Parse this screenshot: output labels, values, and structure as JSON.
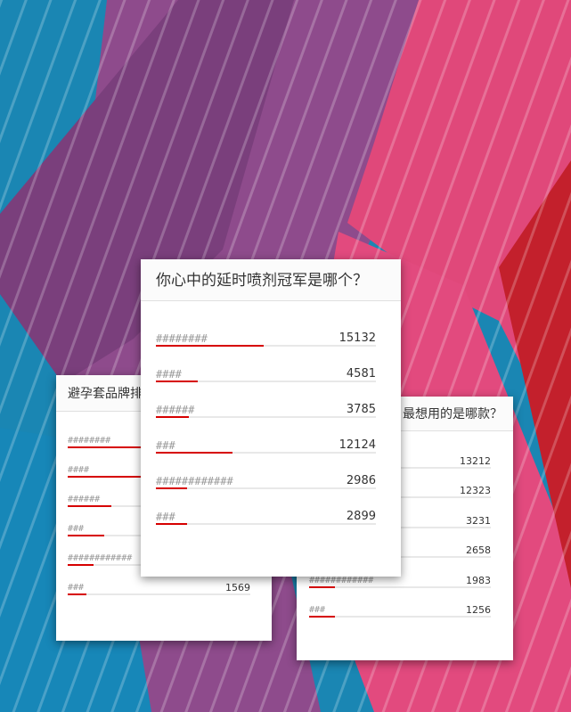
{
  "background": {
    "colors": [
      "#1a86b3",
      "#8e4b8c",
      "#e0487a",
      "#c3202c"
    ]
  },
  "polls": [
    {
      "title": "避孕套品牌排",
      "accent_color": "#d60000",
      "items": [
        {
          "name": "########",
          "votes": "",
          "fill": 0.58
        },
        {
          "name": "####",
          "votes": "",
          "fill": 0.56
        },
        {
          "name": "######",
          "votes": "",
          "fill": 0.24
        },
        {
          "name": "###",
          "votes": "",
          "fill": 0.2
        },
        {
          "name": "############",
          "votes": "",
          "fill": 0.14
        },
        {
          "name": "###",
          "votes": "1569",
          "fill": 0.1
        }
      ]
    },
    {
      "title": "最想用的是哪款？",
      "accent_color": "#d60000",
      "items": [
        {
          "name": "",
          "votes": "13212",
          "fill": 0
        },
        {
          "name": "",
          "votes": "12323",
          "fill": 0
        },
        {
          "name": "",
          "votes": "3231",
          "fill": 0
        },
        {
          "name": "",
          "votes": "2658",
          "fill": 0
        },
        {
          "name": "############",
          "votes": "1983",
          "fill": 0.14
        },
        {
          "name": "###",
          "votes": "1256",
          "fill": 0.14
        }
      ]
    },
    {
      "title": "你心中的延时喷剂冠军是哪个？",
      "accent_color": "#d60000",
      "items": [
        {
          "name": "########",
          "votes": "15132",
          "fill": 0.49
        },
        {
          "name": "####",
          "votes": "4581",
          "fill": 0.19
        },
        {
          "name": "######",
          "votes": "3785",
          "fill": 0.15
        },
        {
          "name": "###",
          "votes": "12124",
          "fill": 0.35
        },
        {
          "name": "############",
          "votes": "2986",
          "fill": 0.14
        },
        {
          "name": "###",
          "votes": "2899",
          "fill": 0.14
        }
      ]
    }
  ]
}
